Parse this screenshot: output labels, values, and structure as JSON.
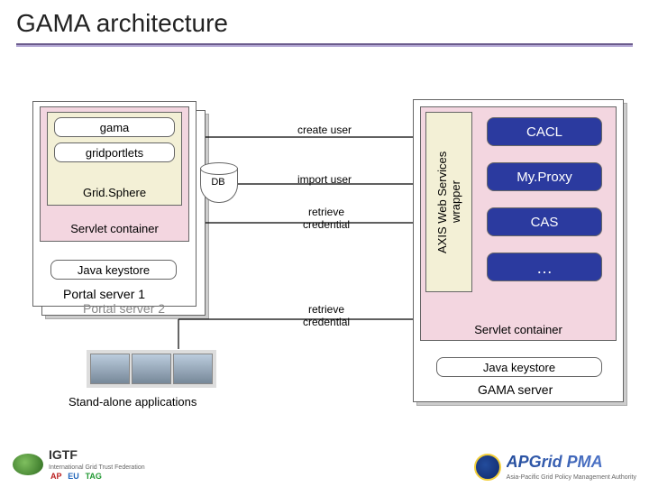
{
  "title": "GAMA architecture",
  "left": {
    "gama": "gama",
    "gridportlets": "gridportlets",
    "gridsphere": "Grid.Sphere",
    "servlet": "Servlet container",
    "keystore": "Java keystore",
    "portal1": "Portal server 1",
    "portal2": "Portal server 2",
    "db": "DB",
    "standalone": "Stand-alone applications"
  },
  "arrows": {
    "create": "create user",
    "import": "import user",
    "retrieve1": "retrieve\ncredential",
    "retrieve2": "retrieve\ncredential"
  },
  "right": {
    "axis": "AXIS Web Services\nwrapper",
    "cacl": "CACL",
    "myproxy": "My.Proxy",
    "cas": "CAS",
    "dots": "…",
    "servlet": "Servlet container",
    "keystore": "Java keystore",
    "gama_server": "GAMA server"
  },
  "footer": {
    "igtf": "IGTF",
    "igtf_sub": "International Grid Trust Federation",
    "ap": "AP",
    "eu": "EU",
    "tag": "TAG",
    "apgrid": "APGrid PMA",
    "apgrid_sub": "Asia-Pacific Grid Policy Management Authority"
  }
}
